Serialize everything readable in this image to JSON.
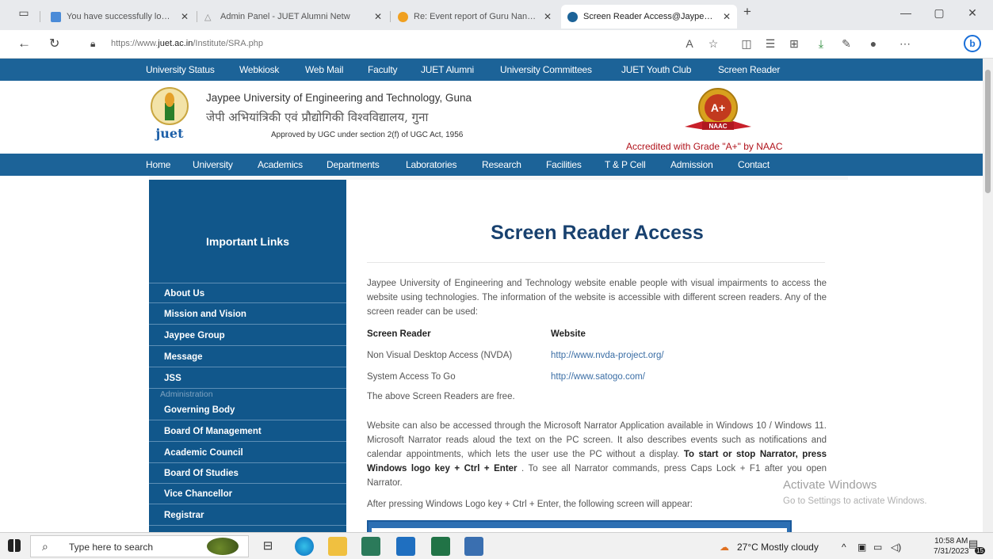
{
  "browser": {
    "tabs": [
      {
        "title": "You have successfully logged on.",
        "favicon_color": "#4a8bd8"
      },
      {
        "title": "Admin Panel - JUET Alumni Netw",
        "favicon_color": "#9aa0a6"
      },
      {
        "title": "Re: Event report of Guru Nanak Ja",
        "favicon_color": "#f0a020"
      },
      {
        "title": "Screen Reader Access@Jaypee U",
        "favicon_color": "#1c6398"
      }
    ],
    "url_prefix": "https://www.",
    "url_domain": "juet.ac.in",
    "url_path": "/Institute/SRA.php"
  },
  "site": {
    "top_nav": [
      "University Status",
      "Webkiosk",
      "Web Mail",
      "Faculty",
      "JUET Alumni",
      "University Committees",
      "JUET Youth Club",
      "Screen Reader"
    ],
    "uni_name_en": "Jaypee University of Engineering and Technology, Guna",
    "uni_name_hi": "जेपी अभियांत्रिकी एवं प्रौद्योगिकी विश्वविद्यालय, गुना",
    "approved": "Approved by UGC under section 2(f) of UGC Act, 1956",
    "logo_text": "juet",
    "naac_badge": "A+",
    "naac_small": "NAAC",
    "naac_text": "Accredited with Grade \"A+\" by NAAC",
    "main_nav": [
      "Home",
      "University",
      "Academics",
      "Departments",
      "Laboratories",
      "Research",
      "Facilities",
      "T & P Cell",
      "Admission",
      "Contact"
    ]
  },
  "sidebar": {
    "heading": "Important Links",
    "items": [
      "About Us",
      "Mission and Vision",
      "Jaypee Group",
      "Message",
      "JSS"
    ],
    "section_label": "Administration",
    "admin_items": [
      "Governing Body",
      "Board Of Management",
      "Academic Council",
      "Board Of Studies",
      "Vice Chancellor",
      "Registrar"
    ]
  },
  "main": {
    "title": "Screen Reader Access",
    "intro": "Jaypee University of Engineering and Technology website enable people with visual impairments to access the website using technologies. The information of the website is accessible with different screen readers. Any of the screen reader can be used:",
    "col_reader": "Screen Reader",
    "col_website": "Website",
    "readers": [
      {
        "name": "Non Visual Desktop Access (NVDA)",
        "url": "http://www.nvda-project.org/"
      },
      {
        "name": "System Access To Go",
        "url": "http://www.satogo.com/"
      }
    ],
    "free_note": "The above Screen Readers are free.",
    "narrator_para_a": "Website can also be accessed through the Microsoft Narrator Application available in Windows 10 / Windows 11. Microsoft Narrator reads aloud the text on the PC screen. It also describes events such as notifications and calendar appointments, which lets the user use the PC without a display. ",
    "narrator_bold": "To start or stop Narrator, press Windows logo key + Ctrl + Enter",
    "narrator_para_b": " . To see all Narrator commands, press Caps Lock + F1 after you open Narrator.",
    "after_text": "After pressing Windows Logo key + Ctrl + Enter, the following screen will appear:"
  },
  "watermark": {
    "line1": "Activate Windows",
    "line2": "Go to Settings to activate Windows."
  },
  "taskbar": {
    "search_placeholder": "Type here to search",
    "weather": "27°C  Mostly cloudy",
    "time": "10:58 AM",
    "date": "7/31/2023",
    "notif_count": "15"
  }
}
